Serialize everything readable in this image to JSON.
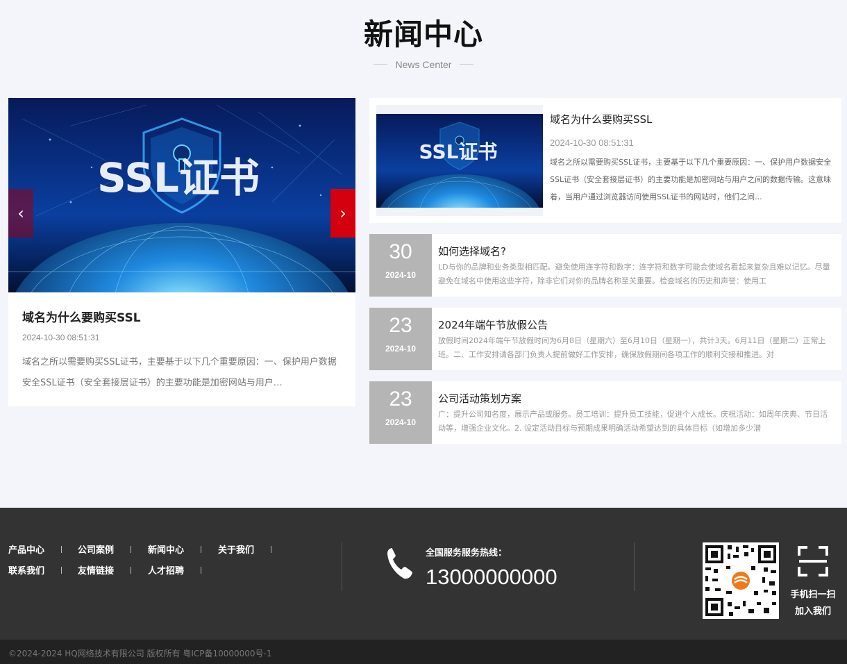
{
  "header": {
    "title": "新闻中心",
    "subtitle": "News Center"
  },
  "featured": {
    "banner_text": "SSL证书",
    "title": "域名为什么要购买SSL",
    "date": "2024-10-30 08:51:31",
    "desc": "域名之所以需要购买SSL证书，主要基于以下几个重要原因：一、保护用户数据安全SSL证书（安全套接层证书）的主要功能是加密网站与用户…",
    "prev_icon": "chevron-left-icon",
    "next_icon": "chevron-right-icon"
  },
  "top_news": {
    "thumb_text": "SSL证书",
    "title": "域名为什么要购买SSL",
    "date": "2024-10-30 08:51:31",
    "desc": "域名之所以需要购买SSL证书，主要基于以下几个重要原因：一、保护用户数据安全SSL证书（安全套接层证书）的主要功能是加密网站与用户之间的数据传输。这意味着，当用户通过浏览器访问使用SSL证书的网站时，他们之间..."
  },
  "news_list": [
    {
      "day": "30",
      "ym": "2024-10",
      "title": "如何选择域名?",
      "desc": "LD与你的品牌和业务类型相匹配。避免使用连字符和数字：连字符和数字可能会使域名看起来复杂且难以记忆。尽量避免在域名中使用这些字符，除非它们对你的品牌名称至关重要。检查域名的历史和声誉：使用工"
    },
    {
      "day": "23",
      "ym": "2024-10",
      "title": "2024年端午节放假公告",
      "desc": "放假时间2024年端午节放假时间为6月8日（星期六）至6月10日（星期一），共计3天。6月11日（星期二）正常上班。二、工作安排请各部门负责人提前做好工作安排，确保放假期间各项工作的顺利交接和推进。对"
    },
    {
      "day": "23",
      "ym": "2024-10",
      "title": "公司活动策划方案",
      "desc": "广：提升公司知名度，展示产品或服务。员工培训：提升员工技能，促进个人成长。庆祝活动：如周年庆典、节日活动等，增强企业文化。2. 设定活动目标与预期成果明确活动希望达到的具体目标（如增加多少潜"
    }
  ],
  "footer": {
    "nav": [
      "产品中心",
      "公司案例",
      "新闻中心",
      "关于我们",
      "联系我们",
      "友情链接",
      "人才招聘"
    ],
    "hotline_label": "全国服务服务热线：",
    "hotline_number": "13000000000",
    "phone_icon": "phone-icon",
    "scan_icon": "scan-icon",
    "scan_line1": "手机扫一扫",
    "scan_line2": "加入我们",
    "copyright": "©2024-2024 HQ网络技术有限公司 版权所有 粤ICP备10000000号-1"
  },
  "colors": {
    "accent": "#d4000f",
    "date_box": "#b5b5b5",
    "footer_bg": "#333333",
    "page_bg": "#f4f5fa"
  }
}
